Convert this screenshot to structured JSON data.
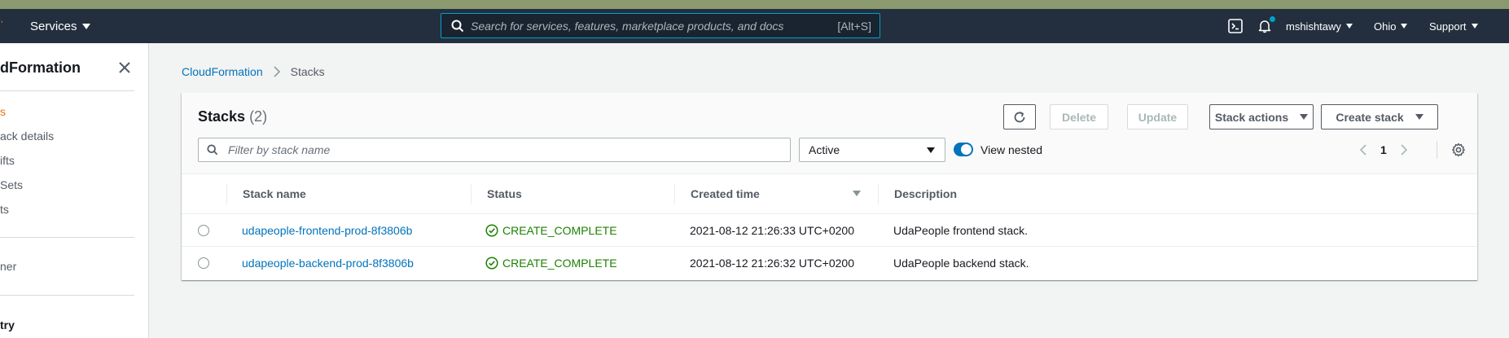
{
  "topnav": {
    "services_label": "Services",
    "search_placeholder": "Search for services, features, marketplace products, and docs",
    "search_shortcut": "[Alt+S]",
    "user": "mshishtawy",
    "region": "Ohio",
    "support": "Support"
  },
  "sidebar": {
    "title": "dFormation",
    "items": [
      {
        "label": "s",
        "active": true
      },
      {
        "label": "ack details"
      },
      {
        "label": "ifts"
      },
      {
        "label": "Sets"
      },
      {
        "label": "ts"
      },
      {
        "label": "ner"
      },
      {
        "label": "try"
      }
    ]
  },
  "breadcrumb": {
    "root": "CloudFormation",
    "current": "Stacks"
  },
  "panel": {
    "title": "Stacks",
    "count": "(2)",
    "buttons": {
      "delete": "Delete",
      "update": "Update",
      "stack_actions": "Stack actions",
      "create_stack": "Create stack"
    },
    "filter_placeholder": "Filter by stack name",
    "status_filter": "Active",
    "view_nested_label": "View nested",
    "view_nested_on": true,
    "page": "1"
  },
  "table": {
    "headers": {
      "name": "Stack name",
      "status": "Status",
      "created": "Created time",
      "description": "Description"
    },
    "rows": [
      {
        "name": "udapeople-frontend-prod-8f3806b",
        "status": "CREATE_COMPLETE",
        "created": "2021-08-12 21:26:33 UTC+0200",
        "description": "UdaPeople frontend stack."
      },
      {
        "name": "udapeople-backend-prod-8f3806b",
        "status": "CREATE_COMPLETE",
        "created": "2021-08-12 21:26:32 UTC+0200",
        "description": "UdaPeople backend stack."
      }
    ]
  },
  "colors": {
    "nav_bg": "#232f3e",
    "link": "#0073bb",
    "success": "#1d8102",
    "active_nav": "#ec7211"
  }
}
